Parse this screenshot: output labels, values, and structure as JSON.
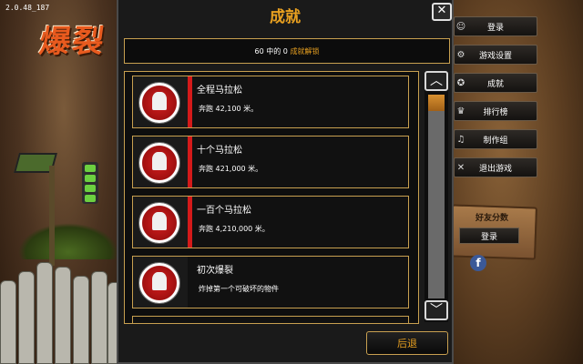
{
  "version": "2.0.48_187",
  "logo_text": "爆裂",
  "dialog": {
    "title": "成就",
    "summary_prefix": "60 中的 0",
    "summary_highlight": "成就解锁",
    "back_label": "后退"
  },
  "achievements": [
    {
      "name": "全程马拉松",
      "desc": "奔跑 42,100 米。"
    },
    {
      "name": "十个马拉松",
      "desc": "奔跑 421,000 米。"
    },
    {
      "name": "一百个马拉松",
      "desc": "奔跑 4,210,000 米。"
    },
    {
      "name": "初次爆裂",
      "desc": "炸掉第一个可破坏的物件"
    }
  ],
  "side_menu": [
    {
      "label": "登录",
      "icon": "user-icon"
    },
    {
      "label": "游戏设置",
      "icon": "gear-icon"
    },
    {
      "label": "成就",
      "icon": "medal-icon"
    },
    {
      "label": "排行榜",
      "icon": "trophy-icon"
    },
    {
      "label": "制作组",
      "icon": "credits-icon"
    },
    {
      "label": "退出游戏",
      "icon": "close-icon"
    }
  ],
  "friends": {
    "title": "好友分数",
    "login_label": "登录",
    "fb_label": "f"
  },
  "colors": {
    "accent": "#e8a020",
    "border": "#c8a050",
    "red": "#d41a1a"
  }
}
